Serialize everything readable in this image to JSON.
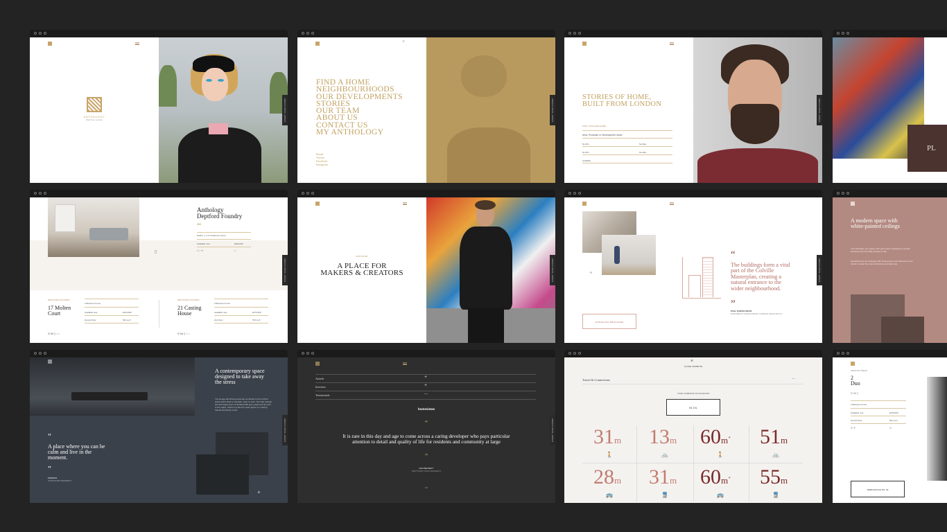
{
  "panels": {
    "p1": {
      "logo_text": "ANTHOLOGY",
      "logo_sub": "Built from London",
      "side_tab": "START YOUR STORY"
    },
    "p2": {
      "menu": [
        "FIND A HOME",
        "NEIGHBOURHOODS",
        "OUR DEVELOPMENTS",
        "STORIES",
        "OUR TEAM",
        "ABOUT US",
        "CONTACT US",
        "MY ANTHOLOGY"
      ],
      "social": [
        "Email",
        "Twitter",
        "Facebook",
        "Instagram"
      ],
      "side_tab": "START YOUR STORY"
    },
    "p3": {
      "headline_1": "STORIES OF HOME,",
      "headline_2": "BUILT FROM LONDON",
      "form_title": "FIND YOUR NEW HOME",
      "field_area": "Area, Postcode or Development name",
      "min_price": "No Min",
      "max_price": "No Max",
      "available": "Available",
      "side_tab": "START YOUR STORY"
    },
    "p4": {
      "text": "PL"
    },
    "p5": {
      "title_1": "Anthology",
      "title_2": "Deptford Foundry",
      "unit_type": "Studio, 1, 2 & 3 bedroom home",
      "status": "Available now",
      "price": "£300,000",
      "cards": [
        {
          "tag": "DEPTFORD FOUNDRY",
          "name_1": "17 Molten",
          "name_2": "Court",
          "beds": "1 Bedroom home",
          "avail": "Available now",
          "price": "£315,000",
          "floor": "Ground floor",
          "size": "542 sq ft"
        },
        {
          "tag": "DEPTFORD FOUNDRY",
          "name_1": "21 Casting",
          "name_2": "House",
          "beds": "2 Bedroom home",
          "avail": "Available now",
          "price": "£475,000",
          "floor": "2nd Floor",
          "size": "732 sq ft"
        }
      ],
      "side_tab": "START YOUR STORY"
    },
    "p6": {
      "tag": "OUR STORY",
      "headline_1": "A PLACE FOR",
      "headline_2": "MAKERS & CREATORS",
      "side_tab": "START YOUR STORY"
    },
    "p7": {
      "quote": "The buildings form a vital part of the Colville Masterplan, creating a natural entrance to the wider neighbourhood.",
      "author": "PAUL KARAKUSEVIC",
      "author_role": "PARTNER AT KARAKUSEVIC CARSON ARCHITECTS",
      "button": "DOWNLOAD BROCHURE",
      "side_tab": "START YOUR STORY"
    },
    "p8": {
      "headline": "A modern space with white-painted ceilings",
      "body_1": "You'll find light, airy spaces with good views, designed to provide sanctuary from the daily stresses of life.",
      "body_2": "All apartments are arranged with living spaces and bedrooms to the corner to make the most of windows and balconies."
    },
    "p9": {
      "headline": "A contemporary space designed to take away the stress",
      "body": "The lounge and dining areas are combined to form a third space that's ideal to entertain, relax or work. The high ceilings and full height doors at Stratford Mill give a light and airy feel to the space, which is perfect for quiet nights in or having friends and family round.",
      "quote": "A place where you can be calm and live in the moment.",
      "author": "FRANCIS",
      "author_role": "STRATFORD RESIDENT",
      "side_tab": "START YOUR STORY"
    },
    "p10": {
      "items": [
        {
          "label": "Awards",
          "sign": "+"
        },
        {
          "label": "Investors",
          "sign": "+"
        },
        {
          "label": "Testimonials",
          "sign": "—"
        }
      ],
      "brand": "homeviews",
      "quote": "It is rare in this day and age to come across a caring developer who pays particular attention to detail and quality of life for residents and community at large",
      "author": "DAN BENNETT",
      "author_role": "DEPTFORD FINCH RESIDENT",
      "page": "1/2",
      "side_tab": "START YOUR STORY"
    },
    "p11": {
      "close": "CLOSE COMMUTE",
      "section": "Travel & Connections",
      "commute_label": "YOUR COMMUTE TO ISLINGTON",
      "postcode": "N1 1XL",
      "stats": [
        {
          "num": "31",
          "unit": "m",
          "sup": "",
          "icon": "walk-icon"
        },
        {
          "num": "13",
          "unit": "m",
          "sup": "",
          "icon": "bike-icon"
        },
        {
          "num": "60",
          "unit": "m",
          "sup": "+",
          "icon": "walk-icon"
        },
        {
          "num": "51",
          "unit": "m",
          "sup": "",
          "icon": "bike-icon"
        },
        {
          "num": "28",
          "unit": "m",
          "sup": "",
          "icon": "bus-icon"
        },
        {
          "num": "31",
          "unit": "m",
          "sup": "",
          "icon": "train-icon"
        },
        {
          "num": "60",
          "unit": "m",
          "sup": "+",
          "icon": "bus-icon"
        },
        {
          "num": "55",
          "unit": "m",
          "sup": "",
          "icon": "train-icon"
        }
      ]
    },
    "p12": {
      "tag": "WESTON PRESS",
      "title_1": "2",
      "title_2": "Duo",
      "beds": "1 Bedroom home",
      "avail": "Available now",
      "price": "£375,000",
      "floor": "Ground floor",
      "size": "591 sq ft",
      "button": "REMOVE DUO NO. 02"
    }
  },
  "colors": {
    "gold": "#c1a05f",
    "rose": "#a9675c",
    "dark": "#2e2e2e",
    "slate": "#3a3f47",
    "dust": "#b38a82"
  }
}
